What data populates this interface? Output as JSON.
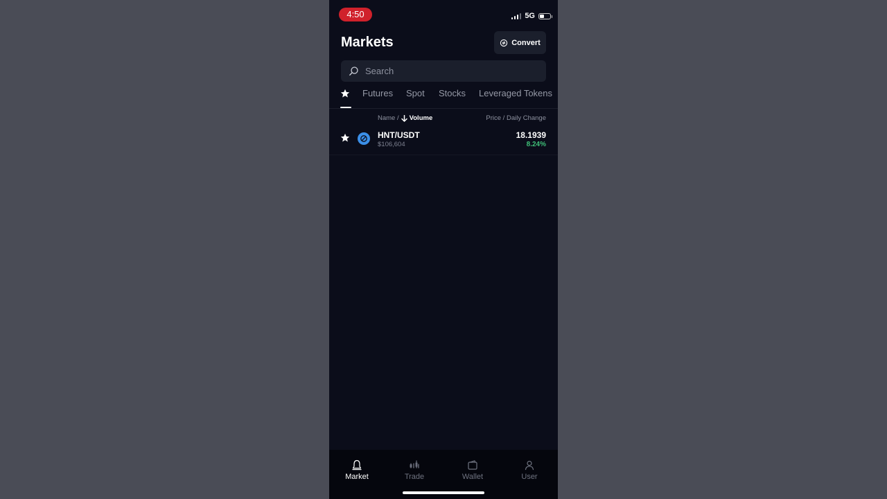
{
  "status_bar": {
    "time": "4:50",
    "network": "5G"
  },
  "header": {
    "title": "Markets",
    "convert_label": "Convert"
  },
  "search": {
    "placeholder": "Search"
  },
  "tabs": [
    {
      "label": "Futures"
    },
    {
      "label": "Spot"
    },
    {
      "label": "Stocks"
    },
    {
      "label": "Leveraged Tokens"
    }
  ],
  "list_header": {
    "name_label": "Name /",
    "sort_label": "Volume",
    "right_label": "Price / Daily Change"
  },
  "rows": [
    {
      "pair": "HNT/USDT",
      "volume": "$106,604",
      "price": "18.1939",
      "change": "8.24%"
    }
  ],
  "bottom_nav": [
    {
      "label": "Market",
      "icon": "market-icon",
      "active": true
    },
    {
      "label": "Trade",
      "icon": "trade-icon",
      "active": false
    },
    {
      "label": "Wallet",
      "icon": "wallet-icon",
      "active": false
    },
    {
      "label": "User",
      "icon": "user-icon",
      "active": false
    }
  ],
  "colors": {
    "background": "#0b0d1a",
    "status_time_bg": "#d0212b",
    "positive": "#3fbf78",
    "coin": "#3b8fe8"
  }
}
